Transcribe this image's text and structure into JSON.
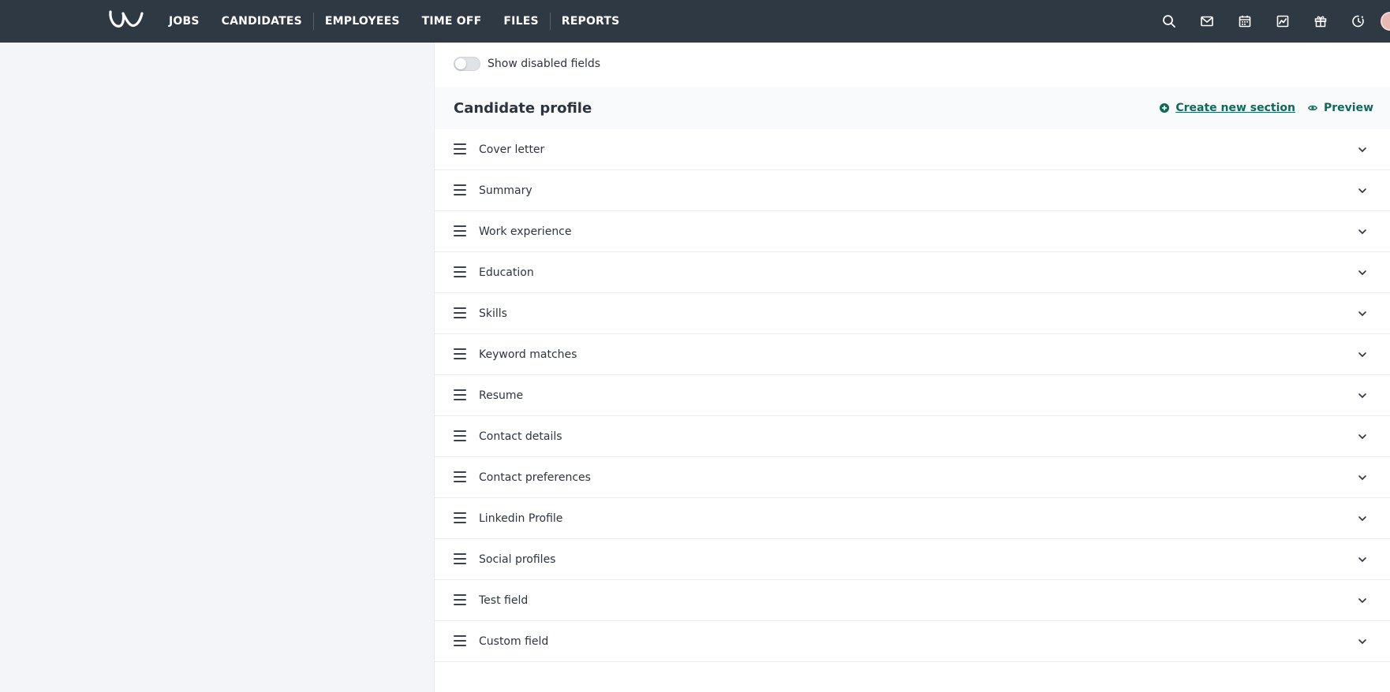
{
  "nav": {
    "items": [
      {
        "label": "JOBS",
        "key": "jobs"
      },
      {
        "label": "CANDIDATES",
        "key": "candidates"
      },
      {
        "label": "EMPLOYEES",
        "key": "employees"
      },
      {
        "label": "TIME OFF",
        "key": "time-off"
      },
      {
        "label": "FILES",
        "key": "files"
      },
      {
        "label": "REPORTS",
        "key": "reports"
      }
    ],
    "tools": [
      "search-icon",
      "mail-icon",
      "calendar-icon",
      "analytics-icon",
      "gift-icon",
      "timer-icon"
    ]
  },
  "toggle": {
    "label": "Show disabled fields",
    "enabled": false
  },
  "section": {
    "title": "Candidate profile",
    "create_label": "Create new section",
    "preview_label": "Preview"
  },
  "fields": [
    "Cover letter",
    "Summary",
    "Work experience",
    "Education",
    "Skills",
    "Keyword matches",
    "Resume",
    "Contact details",
    "Contact preferences",
    "Linkedin Profile",
    "Social profiles",
    "Test field",
    "Custom field"
  ],
  "colors": {
    "topbar": "#2f3943",
    "accent": "#0e6b5b",
    "page_bg": "#f3f5f9"
  }
}
